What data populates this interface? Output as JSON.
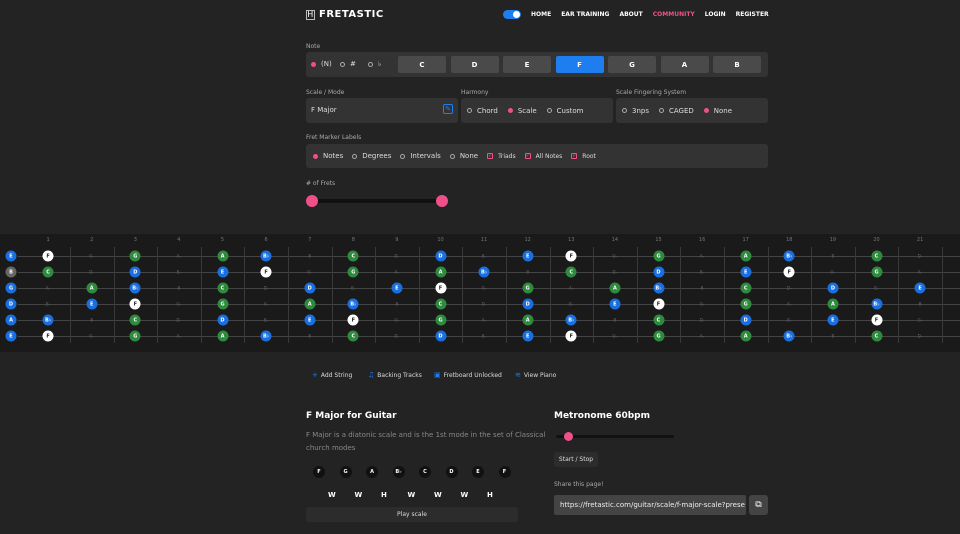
{
  "header": {
    "logo": "FRETASTIC",
    "logo_icon": "fretboard-icon",
    "nav": [
      "HOME",
      "EAR TRAINING",
      "ABOUT",
      "COMMUNITY",
      "LOGIN",
      "REGISTER"
    ]
  },
  "note": {
    "label": "Note",
    "accidentals": [
      "(N)",
      "#",
      "♭"
    ],
    "notes": [
      "C",
      "D",
      "E",
      "F",
      "G",
      "A",
      "B"
    ],
    "selected": "F"
  },
  "scale": {
    "label": "Scale / Mode",
    "value": "F Major"
  },
  "harmony": {
    "label": "Harmony",
    "options": [
      "Chord",
      "Scale",
      "Custom"
    ],
    "selected": "Scale"
  },
  "fingering": {
    "label": "Scale Fingering System",
    "options": [
      "3nps",
      "CAGED",
      "None"
    ],
    "selected": "None"
  },
  "markers": {
    "label": "Fret Marker Labels",
    "options": [
      "Notes",
      "Degrees",
      "Intervals",
      "None"
    ],
    "selected": "Notes",
    "checks": [
      "Triads",
      "All Notes",
      "Root"
    ]
  },
  "frets": {
    "label": "# of Frets"
  },
  "fretboard": {
    "numbers": [
      "1",
      "2",
      "3",
      "4",
      "5",
      "6",
      "7",
      "8",
      "9",
      "10",
      "11",
      "12",
      "13",
      "14",
      "15",
      "16",
      "17",
      "18",
      "19",
      "20",
      "21"
    ],
    "open": [
      "E",
      "B",
      "G",
      "D",
      "A",
      "E"
    ]
  },
  "toolbar": {
    "items": [
      "Add String",
      "Backing Tracks",
      "Fretboard Unlocked",
      "View Piano"
    ]
  },
  "info": {
    "title": "F Major for Guitar",
    "description": "F Major is a diatonic scale and is the 1st mode in the set of Classical church modes",
    "scale_notes": [
      "F",
      "G",
      "A",
      "B♭",
      "C",
      "D",
      "E",
      "F"
    ],
    "steps": [
      "W",
      "W",
      "H",
      "W",
      "W",
      "W",
      "H"
    ],
    "play": "Play scale"
  },
  "metronome": {
    "title": "Metronome 60bpm",
    "start": "Start / Stop"
  },
  "share": {
    "label": "Share this page!",
    "url": "https://fretastic.com/guitar/scale/f-major-scale?prese"
  },
  "colors": {
    "accent": "#1e7ef0",
    "pink": "#f0508a",
    "green": "#2e8b3e"
  }
}
